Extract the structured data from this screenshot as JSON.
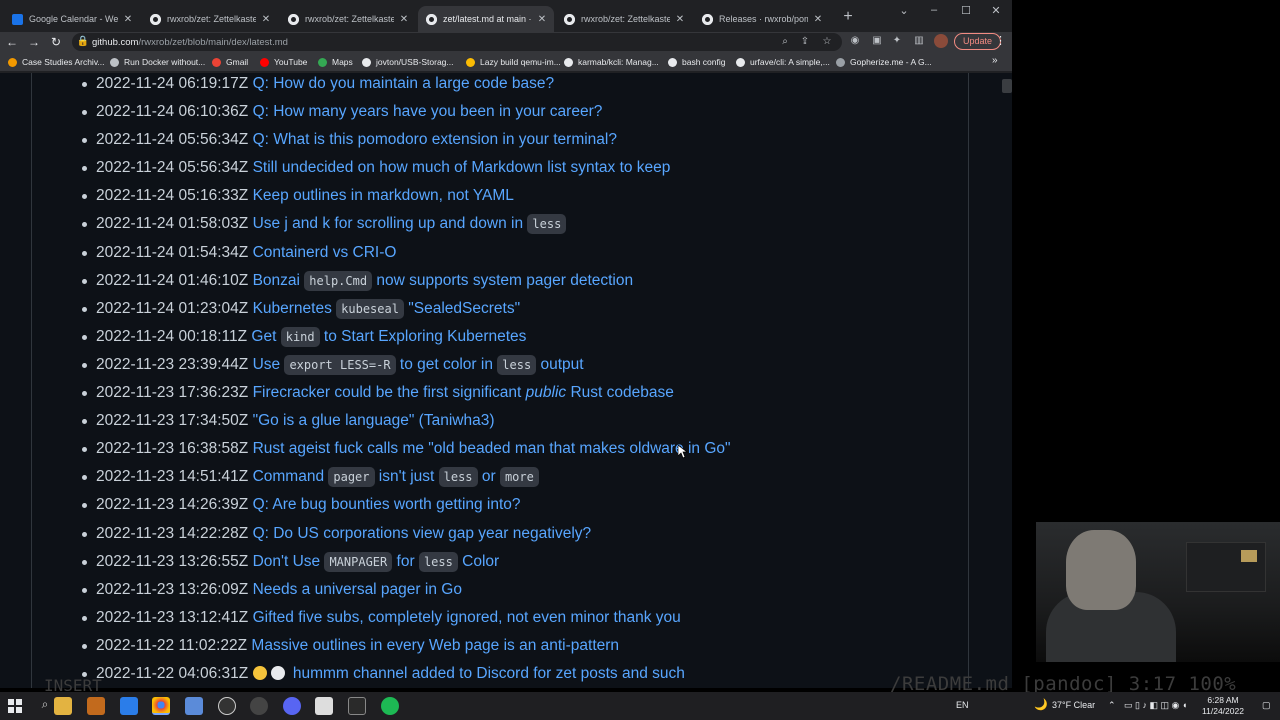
{
  "tabs": [
    {
      "title": "Google Calendar - Week of",
      "icon": "calendar-icon",
      "active": false
    },
    {
      "title": "rwxrob/zet: Zettelkasten Re",
      "icon": "github-icon",
      "active": false
    },
    {
      "title": "rwxrob/zet: Zettelkasten Re",
      "icon": "github-icon",
      "active": false
    },
    {
      "title": "zet/latest.md at main · rwx",
      "icon": "github-icon",
      "active": true
    },
    {
      "title": "rwxrob/zet: Zettelkasten Re",
      "icon": "github-icon",
      "active": false
    },
    {
      "title": "Releases · rwxrob/pomo",
      "icon": "github-icon",
      "active": false
    }
  ],
  "address": {
    "host": "github.com",
    "path": "/rwxrob/zet/blob/main/dex/latest.md"
  },
  "toolbar": {
    "update_label": "Update"
  },
  "bookmarks": [
    {
      "label": "Case Studies Archiv...",
      "color": "#f29900"
    },
    {
      "label": "Run Docker without...",
      "color": "#bdc1c6"
    },
    {
      "label": "Gmail",
      "color": "#ea4335"
    },
    {
      "label": "YouTube",
      "color": "#ff0000"
    },
    {
      "label": "Maps",
      "color": "#34a853"
    },
    {
      "label": "jovton/USB-Storag...",
      "color": "#e8eaed"
    },
    {
      "label": "Lazy build qemu-im...",
      "color": "#fbbc04"
    },
    {
      "label": "karmab/kcli: Manag...",
      "color": "#e8eaed"
    },
    {
      "label": "bash config",
      "color": "#e8eaed"
    },
    {
      "label": "urfave/cli: A simple,...",
      "color": "#e8eaed"
    },
    {
      "label": "Gopherize.me - A G...",
      "color": "#9aa0a6"
    }
  ],
  "entries": [
    {
      "stamp": "2022-11-24 06:19:17Z",
      "parts": [
        {
          "t": "Q: How do you maintain a large code base?"
        }
      ]
    },
    {
      "stamp": "2022-11-24 06:10:36Z",
      "parts": [
        {
          "t": "Q: How many years have you been in your career?"
        }
      ]
    },
    {
      "stamp": "2022-11-24 05:56:34Z",
      "parts": [
        {
          "t": "Q: What is this pomodoro extension in your terminal?"
        }
      ]
    },
    {
      "stamp": "2022-11-24 05:56:34Z",
      "parts": [
        {
          "t": "Still undecided on how much of Markdown list syntax to keep"
        }
      ]
    },
    {
      "stamp": "2022-11-24 05:16:33Z",
      "parts": [
        {
          "t": "Keep outlines in markdown, not YAML"
        }
      ]
    },
    {
      "stamp": "2022-11-24 01:58:03Z",
      "parts": [
        {
          "t": "Use j and k for scrolling up and down in "
        },
        {
          "c": "less"
        }
      ]
    },
    {
      "stamp": "2022-11-24 01:54:34Z",
      "parts": [
        {
          "t": "Containerd vs CRI-O"
        }
      ]
    },
    {
      "stamp": "2022-11-24 01:46:10Z",
      "parts": [
        {
          "t": "Bonzai "
        },
        {
          "c": "help.Cmd"
        },
        {
          "t": " now supports system pager detection"
        }
      ]
    },
    {
      "stamp": "2022-11-24 01:23:04Z",
      "parts": [
        {
          "t": "Kubernetes "
        },
        {
          "c": "kubeseal"
        },
        {
          "t": " \"SealedSecrets\""
        }
      ]
    },
    {
      "stamp": "2022-11-24 00:18:11Z",
      "parts": [
        {
          "t": "Get "
        },
        {
          "c": "kind"
        },
        {
          "t": " to Start Exploring Kubernetes"
        }
      ]
    },
    {
      "stamp": "2022-11-23 23:39:44Z",
      "parts": [
        {
          "t": "Use "
        },
        {
          "c": "export LESS=-R"
        },
        {
          "t": " to get color in "
        },
        {
          "c": "less"
        },
        {
          "t": " output"
        }
      ]
    },
    {
      "stamp": "2022-11-23 17:36:23Z",
      "parts": [
        {
          "t": "Firecracker could be the first significant "
        },
        {
          "e": "public"
        },
        {
          "t": " Rust codebase"
        }
      ]
    },
    {
      "stamp": "2022-11-23 17:34:50Z",
      "parts": [
        {
          "t": "\"Go is a glue language\" (Taniwha3)"
        }
      ]
    },
    {
      "stamp": "2022-11-23 16:38:58Z",
      "parts": [
        {
          "t": "Rust ageist fuck calls me \"old beaded man that makes oldware in Go\""
        }
      ]
    },
    {
      "stamp": "2022-11-23 14:51:41Z",
      "parts": [
        {
          "t": "Command "
        },
        {
          "c": "pager"
        },
        {
          "t": " isn't just "
        },
        {
          "c": "less"
        },
        {
          "t": " or "
        },
        {
          "c": "more"
        }
      ]
    },
    {
      "stamp": "2022-11-23 14:26:39Z",
      "parts": [
        {
          "t": "Q: Are bug bounties worth getting into?"
        }
      ]
    },
    {
      "stamp": "2022-11-23 14:22:28Z",
      "parts": [
        {
          "t": "Q: Do US corporations view gap year negatively?"
        }
      ]
    },
    {
      "stamp": "2022-11-23 13:26:55Z",
      "parts": [
        {
          "t": "Don't Use "
        },
        {
          "c": "MANPAGER"
        },
        {
          "t": " for "
        },
        {
          "c": "less"
        },
        {
          "t": " Color"
        }
      ]
    },
    {
      "stamp": "2022-11-23 13:26:09Z",
      "parts": [
        {
          "t": "Needs a universal pager in Go"
        }
      ]
    },
    {
      "stamp": "2022-11-23 13:12:41Z",
      "parts": [
        {
          "t": "Gifted five subs, completely ignored, not even minor thank you"
        }
      ]
    },
    {
      "stamp": "2022-11-22 11:02:22Z",
      "parts": [
        {
          "t": "Massive outlines in every Web page is an anti-pattern"
        }
      ]
    },
    {
      "stamp": "2022-11-22 04:06:31Z",
      "parts": [
        {
          "emoji": "thinking-face-icon"
        },
        {
          "emoji": "thought-bubble-icon"
        },
        {
          "t": " hummm channel added to Discord for zet posts and such"
        }
      ]
    }
  ],
  "terminal": {
    "mode": "INSERT",
    "status": "/README.md [pandoc] 3:17 100%"
  },
  "taskbar": {
    "language": "EN",
    "weather": "37°F  Clear",
    "time": "6:28 AM",
    "date": "11/24/2022"
  },
  "colors": {
    "link": "#58a6ff",
    "text": "#c9d1d9",
    "page_bg": "#0d1117"
  }
}
